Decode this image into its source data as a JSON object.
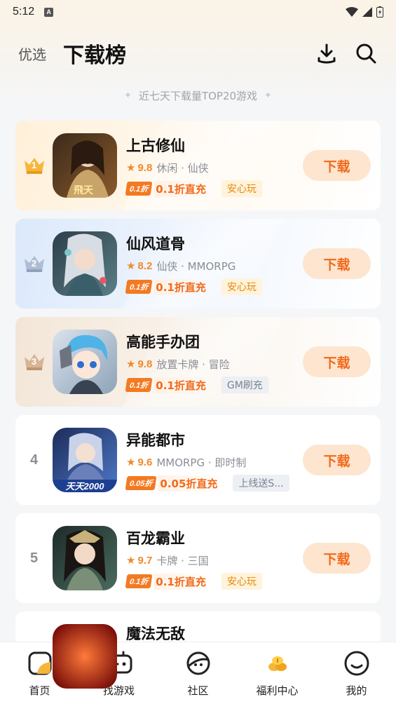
{
  "status_bar": {
    "time": "5:12",
    "badge": "A"
  },
  "header": {
    "tab_featured": "优选",
    "tab_ranking": "下载榜",
    "download_icon": "download-icon",
    "search_icon": "search-icon"
  },
  "subtitle": "近七天下载量TOP20游戏",
  "games": [
    {
      "rank": "1",
      "name": "上古修仙",
      "rating": "9.8",
      "tags": "休闲 · 仙侠",
      "discount_badge": "0.1折",
      "discount_text": "0.1折直充",
      "tag_badge": "安心玩",
      "button": "下载"
    },
    {
      "rank": "2",
      "name": "仙风道骨",
      "rating": "8.2",
      "tags": "仙侠 · MMORPG",
      "discount_badge": "0.1折",
      "discount_text": "0.1折直充",
      "tag_badge": "安心玩",
      "button": "下载"
    },
    {
      "rank": "3",
      "name": "高能手办团",
      "rating": "9.8",
      "tags": "放置卡牌 · 冒险",
      "discount_badge": "0.1折",
      "discount_text": "0.1折直充",
      "tag_badge": "GM刷充",
      "button": "下载"
    },
    {
      "rank": "4",
      "name": "异能都市",
      "rating": "9.6",
      "tags": "MMORPG · 即时制",
      "discount_badge": "0.05折",
      "discount_text": "0.05折直充",
      "tag_badge": "上线送S...",
      "button": "下载"
    },
    {
      "rank": "5",
      "name": "百龙霸业",
      "rating": "9.7",
      "tags": "卡牌 · 三国",
      "discount_badge": "0.1折",
      "discount_text": "0.1折直充",
      "tag_badge": "安心玩",
      "button": "下载"
    },
    {
      "name": "魔法无敌"
    }
  ],
  "icon_art_text": {
    "game1": "飛天",
    "game4": "天天2000"
  },
  "nav": [
    {
      "label": "首页",
      "icon": "home-icon"
    },
    {
      "label": "找游戏",
      "icon": "gamepad-icon"
    },
    {
      "label": "社区",
      "icon": "community-icon"
    },
    {
      "label": "福利中心",
      "icon": "coins-icon"
    },
    {
      "label": "我的",
      "icon": "profile-icon"
    }
  ]
}
